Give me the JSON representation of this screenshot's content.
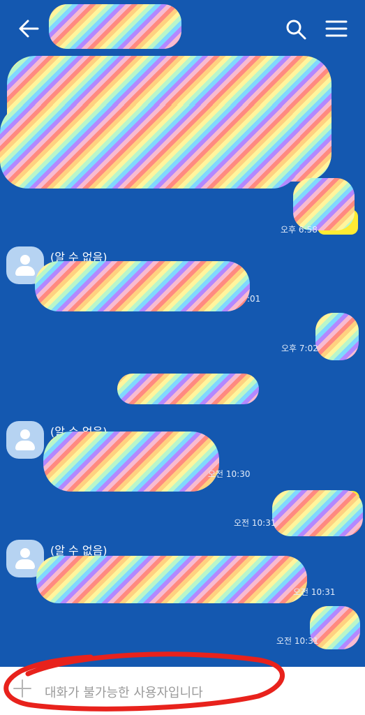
{
  "header": {
    "back_icon": "arrow-left-icon",
    "search_icon": "search-icon",
    "menu_icon": "hamburger-menu-icon"
  },
  "messages": {
    "m1_time": "오후 6:58",
    "m2_sender": "(알 수 없음)",
    "m2_time": ":01",
    "m3_time": "오후 7:02",
    "m4_sender": "(알 수 없음)",
    "m4_time": "오전 10:30",
    "m5_time": "오전 10:31",
    "m6_sender": "(알 수 없음)",
    "m6_time": "오전 10:31",
    "m7_time": "오전 10:31"
  },
  "composer": {
    "plus_icon": "plus-icon",
    "disabled_text": "대화가 불가능한 사용자입니다"
  },
  "colors": {
    "chat_background": "#1458b0",
    "my_bubble": "#ffeb33",
    "other_bubble": "#ffffff",
    "annotation_red": "#e8221c"
  }
}
